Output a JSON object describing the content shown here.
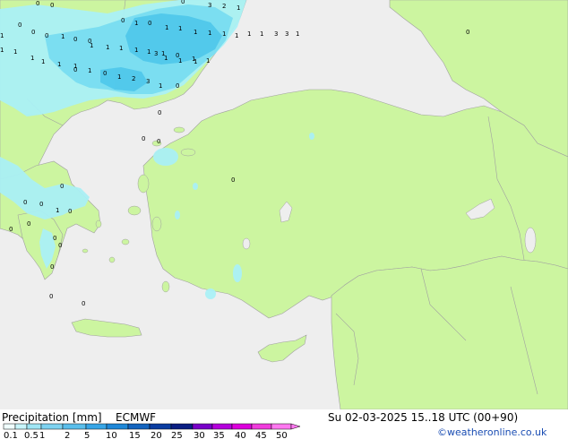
{
  "header": {
    "title": "Precipitation [mm]",
    "model": "ECMWF",
    "valid_time": "Su 02-03-2025 15..18 UTC (00+90)",
    "credit": "©weatheronline.co.uk"
  },
  "legend": {
    "ticks": [
      "0.1",
      "0.5",
      "1",
      "2",
      "5",
      "10",
      "15",
      "20",
      "25",
      "30",
      "35",
      "40",
      "45",
      "50"
    ],
    "colors": [
      "#f0ffff",
      "#c8f5fa",
      "#a0e6f5",
      "#7dd2f0",
      "#5abeeb",
      "#37a5e6",
      "#1e87d7",
      "#1464be",
      "#0a3ca0",
      "#0a1e82",
      "#7800c8",
      "#b400dc",
      "#dc00dc",
      "#f03cdc",
      "#ff78f0"
    ]
  },
  "colors": {
    "sea": "#eeeeee",
    "land": "#ccf5a0",
    "border": "#a0a0a0",
    "precip_light": "#aaf0f5",
    "precip_medium": "#78dcf0",
    "precip_heavy": "#50c8eb"
  },
  "values": [
    {
      "text": "0"
    },
    {
      "text": "0"
    },
    {
      "text": "0"
    },
    {
      "text": "0"
    },
    {
      "text": "3"
    },
    {
      "text": "2"
    },
    {
      "text": "1"
    },
    {
      "text": "0"
    },
    {
      "text": "0"
    },
    {
      "text": "1"
    },
    {
      "text": "0"
    },
    {
      "text": "1"
    },
    {
      "text": "1"
    },
    {
      "text": "1"
    },
    {
      "text": "0"
    },
    {
      "text": "1"
    },
    {
      "text": "0"
    },
    {
      "text": "0"
    },
    {
      "text": "1"
    },
    {
      "text": "1"
    },
    {
      "text": "1"
    },
    {
      "text": "1"
    },
    {
      "text": "1"
    },
    {
      "text": "1"
    },
    {
      "text": "3"
    },
    {
      "text": "3"
    },
    {
      "text": "1"
    },
    {
      "text": "0"
    },
    {
      "text": "1"
    },
    {
      "text": "1"
    },
    {
      "text": "1"
    },
    {
      "text": "1"
    },
    {
      "text": "1"
    },
    {
      "text": "1"
    },
    {
      "text": "1"
    },
    {
      "text": "1"
    },
    {
      "text": "1"
    },
    {
      "text": "1"
    },
    {
      "text": "1"
    },
    {
      "text": "1"
    },
    {
      "text": "0"
    },
    {
      "text": "1"
    },
    {
      "text": "1"
    },
    {
      "text": "3"
    },
    {
      "text": "1"
    },
    {
      "text": "1"
    },
    {
      "text": "1"
    },
    {
      "text": "0"
    },
    {
      "text": "1"
    },
    {
      "text": "0"
    },
    {
      "text": "1"
    },
    {
      "text": "2"
    },
    {
      "text": "3"
    },
    {
      "text": "1"
    },
    {
      "text": "0"
    },
    {
      "text": "0"
    },
    {
      "text": "0"
    },
    {
      "text": "0"
    },
    {
      "text": "0"
    },
    {
      "text": "0"
    },
    {
      "text": "0"
    },
    {
      "text": "0"
    },
    {
      "text": "1"
    },
    {
      "text": "0"
    },
    {
      "text": "0"
    },
    {
      "text": "0"
    },
    {
      "text": "0"
    },
    {
      "text": "0"
    },
    {
      "text": "0"
    },
    {
      "text": "0"
    },
    {
      "text": "0"
    },
    {
      "text": "0"
    }
  ]
}
